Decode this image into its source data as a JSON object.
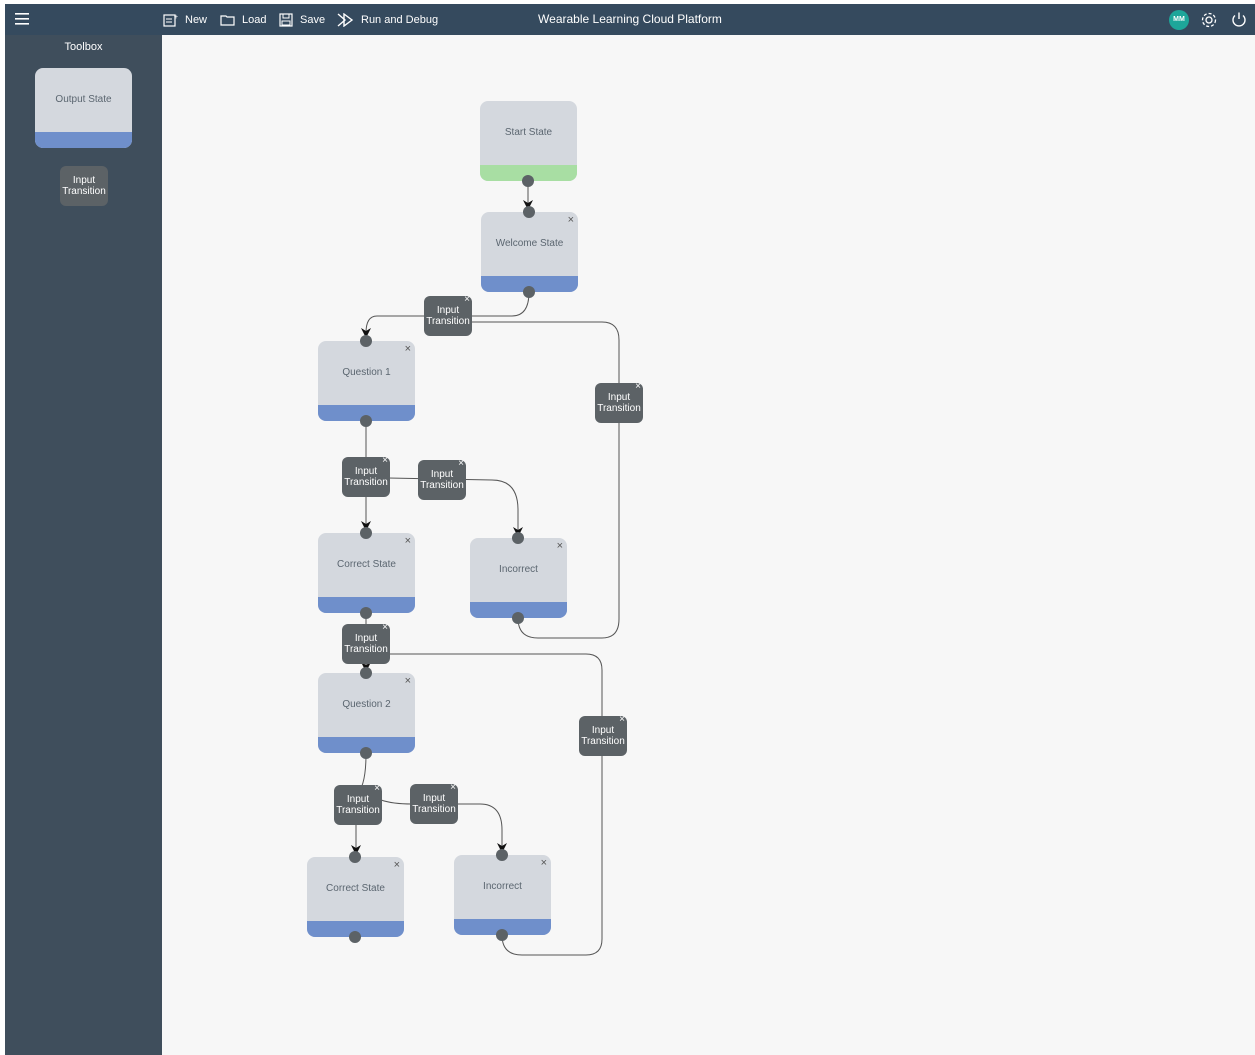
{
  "app": {
    "title": "Wearable Learning Cloud Platform",
    "user_initials": "MM"
  },
  "toolbar": {
    "new_label": "New",
    "load_label": "Load",
    "save_label": "Save",
    "run_label": "Run and Debug"
  },
  "sidebar": {
    "title": "Toolbox",
    "output_state_label": "Output State",
    "input_transition_label": "Input\nTransition"
  },
  "colors": {
    "topbar": "#354a5e",
    "sidebar": "#3f4e5c",
    "node": "#d4d8de",
    "node_bar": "#6f8fcb",
    "start_bar": "#a8dea3",
    "transition": "#5c6266",
    "avatar": "#1ea69a"
  },
  "canvas": {
    "states": [
      {
        "label": "Start State",
        "type": "start",
        "closable": false
      },
      {
        "label": "Welcome State",
        "type": "output",
        "closable": true
      },
      {
        "label": "Question 1",
        "type": "output",
        "closable": true
      },
      {
        "label": "Correct State",
        "type": "output",
        "closable": true
      },
      {
        "label": "Incorrect",
        "type": "output",
        "closable": true
      },
      {
        "label": "Question 2",
        "type": "output",
        "closable": true
      },
      {
        "label": "Correct State",
        "type": "output",
        "closable": true
      },
      {
        "label": "Incorrect",
        "type": "output",
        "closable": true
      }
    ],
    "transition_label": "Input Transition",
    "transitions": [
      {
        "label_top": "Input",
        "label_bottom": "Transition"
      },
      {
        "label_top": "Input",
        "label_bottom": "Transition"
      },
      {
        "label_top": "Input",
        "label_bottom": "Transition"
      },
      {
        "label_top": "Input",
        "label_bottom": "Transition"
      },
      {
        "label_top": "Input",
        "label_bottom": "Transition"
      },
      {
        "label_top": "Input",
        "label_bottom": "Transition"
      },
      {
        "label_top": "Input",
        "label_bottom": "Transition"
      },
      {
        "label_top": "Input",
        "label_bottom": "Transition"
      }
    ],
    "close_glyph": "×"
  }
}
